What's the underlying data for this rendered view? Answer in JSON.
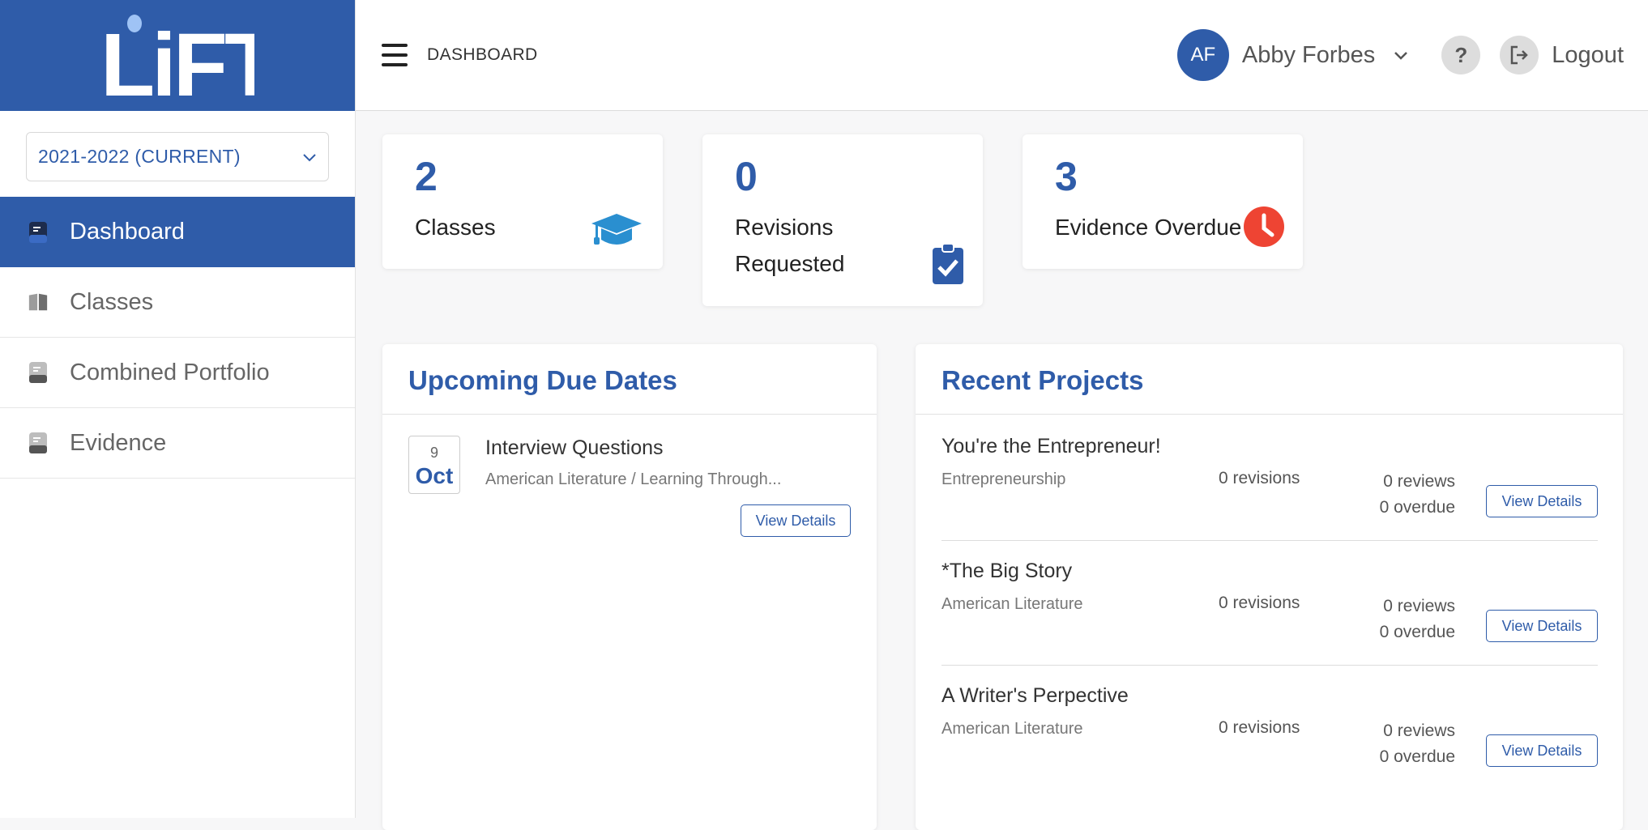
{
  "brand": {
    "logo_text": "LiFT",
    "color": "#2f5ca9"
  },
  "sidebar": {
    "year_select": {
      "value": "2021-2022 (CURRENT)"
    },
    "items": [
      {
        "label": "Dashboard",
        "icon": "book-icon",
        "active": true
      },
      {
        "label": "Classes",
        "icon": "open-book-icon",
        "active": false
      },
      {
        "label": "Combined Portfolio",
        "icon": "book-icon",
        "active": false
      },
      {
        "label": "Evidence",
        "icon": "book-icon",
        "active": false
      }
    ]
  },
  "header": {
    "breadcrumb": "DASHBOARD",
    "user": {
      "initials": "AF",
      "name": "Abby Forbes"
    },
    "help_label": "?",
    "logout_label": "Logout"
  },
  "stats": [
    {
      "value": "2",
      "label": "Classes",
      "icon": "graduation-cap-icon"
    },
    {
      "value": "0",
      "label_line1": "Revisions",
      "label_line2": "Requested",
      "icon": "clipboard-check-icon"
    },
    {
      "value": "3",
      "label": "Evidence Overdue",
      "icon": "clock-alert-icon"
    }
  ],
  "upcoming": {
    "title": "Upcoming Due Dates",
    "items": [
      {
        "day": "9",
        "month": "Oct",
        "title": "Interview Questions",
        "subtitle": "American Literature / Learning Through...",
        "button": "View Details"
      }
    ]
  },
  "recent": {
    "title": "Recent Projects",
    "items": [
      {
        "title": "You're the Entrepreneur!",
        "course": "Entrepreneurship",
        "revisions": "0 revisions",
        "reviews": "0 reviews",
        "overdue": "0 overdue",
        "button": "View Details"
      },
      {
        "title": "*The Big Story",
        "course": "American Literature",
        "revisions": "0 revisions",
        "reviews": "0 reviews",
        "overdue": "0 overdue",
        "button": "View Details"
      },
      {
        "title": "A Writer's Perpective",
        "course": "American Literature",
        "revisions": "0 revisions",
        "reviews": "0 reviews",
        "overdue": "0 overdue",
        "button": "View Details"
      }
    ]
  }
}
